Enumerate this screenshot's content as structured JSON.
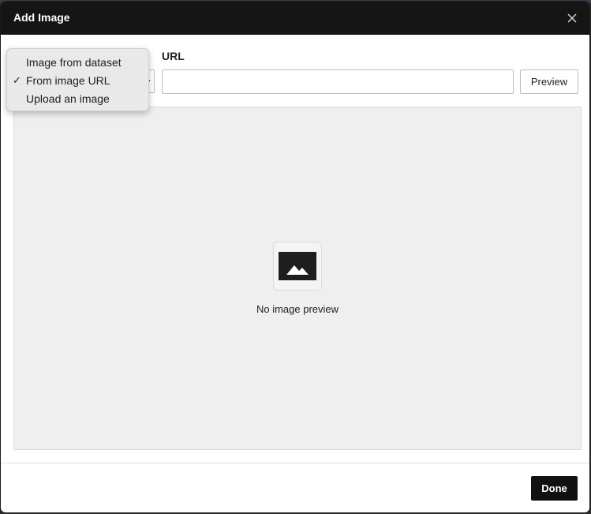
{
  "dialog": {
    "title": "Add Image",
    "close_icon": "close-icon"
  },
  "source_dropdown": {
    "selected": "From image URL",
    "options": [
      {
        "label": "Image from dataset",
        "checked": false
      },
      {
        "label": "From image URL",
        "checked": true
      },
      {
        "label": "Upload an image",
        "checked": false
      }
    ],
    "check_glyph": "✓",
    "chevron_icon": "chevron-down-icon"
  },
  "url_field": {
    "label": "URL",
    "value": "",
    "placeholder": ""
  },
  "preview_button": {
    "label": "Preview"
  },
  "preview_area": {
    "icon": "image-placeholder-icon",
    "empty_text": "No image preview"
  },
  "footer": {
    "done_label": "Done"
  },
  "colors": {
    "header_bg": "#151515",
    "preview_bg": "#efefef",
    "done_bg": "#111111",
    "menu_bg": "#e9e9e9"
  }
}
